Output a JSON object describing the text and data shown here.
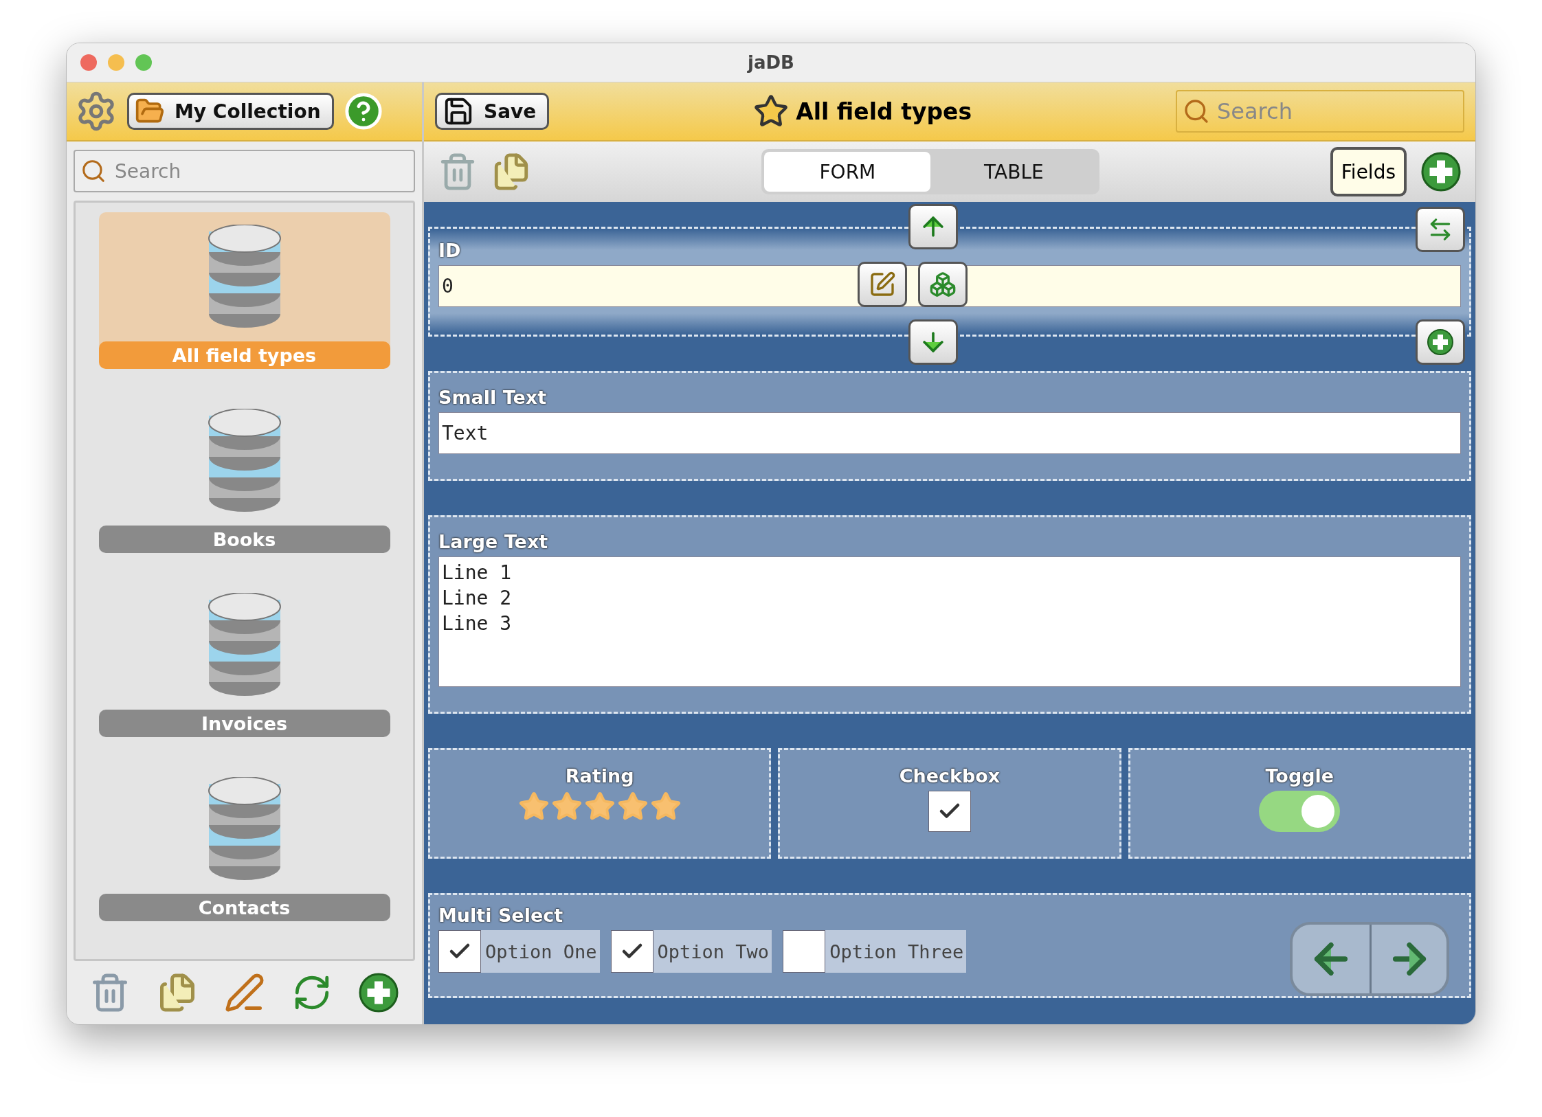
{
  "window": {
    "title": "jaDB"
  },
  "sidebar": {
    "collection_button": "My Collection",
    "search": {
      "placeholder": "Search"
    },
    "items": [
      {
        "label": "All field types",
        "selected": true
      },
      {
        "label": "Books",
        "selected": false
      },
      {
        "label": "Invoices",
        "selected": false
      },
      {
        "label": "Contacts",
        "selected": false
      }
    ]
  },
  "toolbar": {
    "save_button": "Save",
    "title": "All field types",
    "search": {
      "placeholder": "Search"
    }
  },
  "view_tabs": [
    {
      "label": "FORM",
      "selected": true
    },
    {
      "label": "TABLE",
      "selected": false
    }
  ],
  "fields_button": "Fields",
  "form": {
    "fields": [
      {
        "kind": "id",
        "label": "ID",
        "value": "0"
      },
      {
        "kind": "text",
        "label": "Small Text",
        "value": "Text"
      },
      {
        "kind": "textarea",
        "label": "Large Text",
        "lines": [
          "Line 1",
          "Line 2",
          "Line 3"
        ]
      },
      {
        "kind": "rating",
        "label": "Rating",
        "stars": 5
      },
      {
        "kind": "checkbox",
        "label": "Checkbox",
        "checked": true
      },
      {
        "kind": "toggle",
        "label": "Toggle",
        "on": true
      },
      {
        "kind": "multiselect",
        "label": "Multi Select",
        "options": [
          {
            "label": "Option One",
            "checked": true
          },
          {
            "label": "Option Two",
            "checked": true
          },
          {
            "label": "Option Three",
            "checked": false
          }
        ]
      }
    ]
  }
}
